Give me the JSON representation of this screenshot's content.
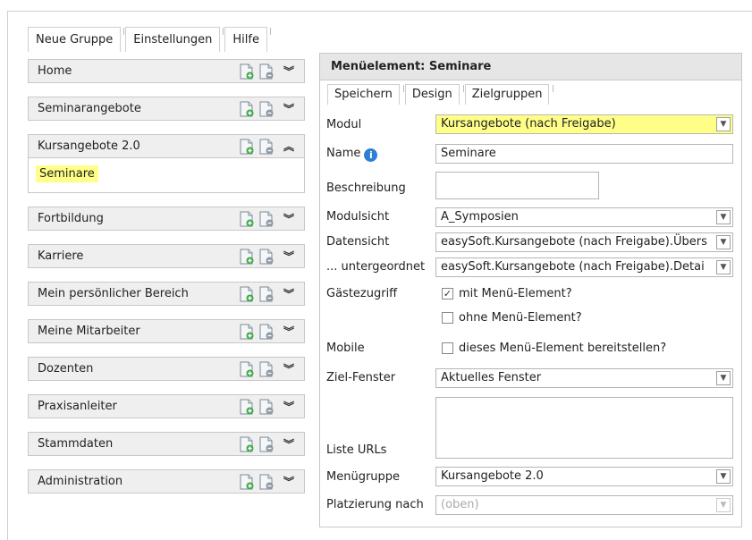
{
  "topbar": {
    "buttons": [
      "Neue Gruppe",
      "Einstellungen",
      "Hilfe"
    ]
  },
  "accordion": {
    "groups": [
      {
        "title": "Home",
        "expanded": false
      },
      {
        "title": "Seminarangebote",
        "expanded": false
      },
      {
        "title": "Kursangebote 2.0",
        "expanded": true,
        "items": [
          "Seminare"
        ]
      },
      {
        "title": "Fortbildung",
        "expanded": false
      },
      {
        "title": "Karriere",
        "expanded": false
      },
      {
        "title": "Mein persönlicher Bereich",
        "expanded": false
      },
      {
        "title": "Meine Mitarbeiter",
        "expanded": false
      },
      {
        "title": "Dozenten",
        "expanded": false
      },
      {
        "title": "Praxisanleiter",
        "expanded": false
      },
      {
        "title": "Stammdaten",
        "expanded": false
      },
      {
        "title": "Administration",
        "expanded": false
      }
    ]
  },
  "panel": {
    "title": "Menüelement: Seminare",
    "tabs": [
      "Speichern",
      "Design",
      "Zielgruppen"
    ],
    "fields": {
      "modul": {
        "label": "Modul",
        "value": "Kursangebote (nach Freigabe)"
      },
      "name": {
        "label": "Name",
        "value": "Seminare"
      },
      "beschreibung": {
        "label": "Beschreibung",
        "value": ""
      },
      "modulsicht": {
        "label": "Modulsicht",
        "value": "A_Symposien"
      },
      "datensicht": {
        "label": "Datensicht",
        "value": "easySoft.Kursangebote (nach Freigabe).Übers"
      },
      "untergeordnet": {
        "label": "... untergeordnet",
        "value": "easySoft.Kursangebote (nach Freigabe).Detai"
      },
      "gaestezugriff": {
        "label": "Gästezugriff",
        "opt1": {
          "label": "mit Menü-Element?",
          "checked": true
        },
        "opt2": {
          "label": "ohne Menü-Element?",
          "checked": false
        }
      },
      "mobile": {
        "label": "Mobile",
        "opt": {
          "label": "dieses Menü-Element bereitstellen?",
          "checked": false
        }
      },
      "zielfenster": {
        "label": "Ziel-Fenster",
        "value": "Aktuelles Fenster"
      },
      "listeurls": {
        "label": "Liste URLs",
        "value": ""
      },
      "menuegruppe": {
        "label": "Menügruppe",
        "value": "Kursangebote 2.0"
      },
      "platzierung": {
        "label": "Platzierung nach",
        "value": "(oben)"
      }
    }
  },
  "icons": {
    "new": "add-document-icon",
    "edit": "edit-document-icon",
    "collapse": "double-chevron-down-icon",
    "expand": "double-chevron-up-icon",
    "info": "info-icon"
  },
  "colors": {
    "highlight": "#ffff88",
    "header_bg": "#efefef",
    "info_blue": "#2d7fd3"
  }
}
